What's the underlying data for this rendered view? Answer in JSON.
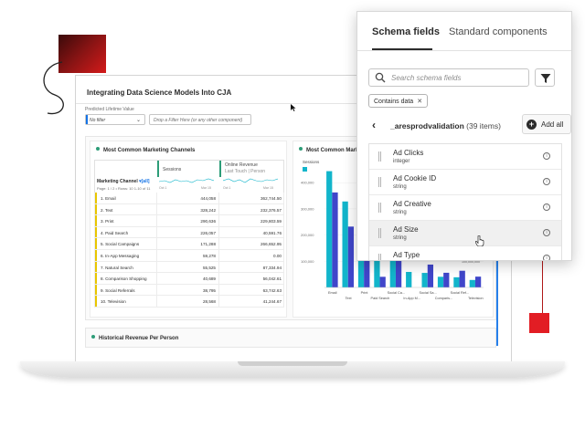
{
  "project": {
    "title": "Integrating Data Science Models Into CJA",
    "dimension_label": "Predicted Lifetime Value",
    "dimension_value": "No filter",
    "drop_zone": "Drop a Filter Here (or any other component)"
  },
  "freeform": {
    "title": "Most Common Marketing Channels",
    "col_sessions": "Sessions",
    "col_revenue": "Online Revenue",
    "col_revenue_sub": "Last Touch | Person",
    "dimension": "Marketing Channel",
    "filter_tag": "[all]",
    "page_info": "Page: 1 / 2 • Rows: 10  1-10 of 11",
    "spark_left": "Oct 1",
    "spark_right": "Mar 15",
    "rows": [
      {
        "name": "1. Email",
        "sessions": "444,058",
        "revenue": "362,744.50"
      },
      {
        "name": "2. Text",
        "sessions": "328,242",
        "revenue": "232,376.57"
      },
      {
        "name": "3. Print",
        "sessions": "290,636",
        "revenue": "229,803.59"
      },
      {
        "name": "4. Paid Search",
        "sessions": "226,057",
        "revenue": "40,591.76"
      },
      {
        "name": "5. Social Campaigns",
        "sessions": "171,288",
        "revenue": "266,652.95"
      },
      {
        "name": "6. In-App Messaging",
        "sessions": "59,278",
        "revenue": "0.00"
      },
      {
        "name": "7. Natural Search",
        "sessions": "55,525",
        "revenue": "87,334.94"
      },
      {
        "name": "8. Comparison Shopping",
        "sessions": "40,689",
        "revenue": "56,042.61"
      },
      {
        "name": "9. Social Referrals",
        "sessions": "38,795",
        "revenue": "63,742.63"
      },
      {
        "name": "10. Television",
        "sessions": "28,568",
        "revenue": "41,244.67"
      }
    ]
  },
  "bar_viz": {
    "title": "Most Common Marketing Channels",
    "legend": "Sessions"
  },
  "chart_data": {
    "type": "bar",
    "categories": [
      "Email",
      "Text",
      "Print",
      "Paid Search",
      "Social Ca...",
      "In-App M...",
      "Social Sa...",
      "Comparis...",
      "Social Ref...",
      "Television"
    ],
    "series": [
      {
        "name": "Sessions",
        "values": [
          444058,
          328242,
          290636,
          226057,
          171288,
          59278,
          55525,
          40689,
          38795,
          28568
        ]
      },
      {
        "values": [
          362744.5,
          232376.57,
          229803.59,
          40591.76,
          266652.95,
          0,
          87334.94,
          56042.61,
          63742.63,
          41244.67
        ]
      }
    ],
    "y_ticks": [
      "400,000",
      "300,000",
      "200,000",
      "100,000"
    ],
    "right_tick": "100,000,000",
    "ylim": [
      0,
      460000
    ],
    "colors": [
      "#12b5cb",
      "#4046ca"
    ]
  },
  "collapsed_viz": {
    "title": "Historical Revenue Per Person"
  },
  "schema": {
    "tab_active": "Schema fields",
    "tab_other": "Standard components",
    "search_placeholder": "Search schema fields",
    "chip": "Contains data",
    "path": "_aresprodvalidation",
    "count": "(39 items)",
    "add_all": "Add all",
    "items": [
      {
        "name": "Ad Clicks",
        "type": "integer"
      },
      {
        "name": "Ad Cookie ID",
        "type": "string"
      },
      {
        "name": "Ad Creative",
        "type": "string"
      },
      {
        "name": "Ad Size",
        "type": "string"
      },
      {
        "name": "Ad Type",
        "type": "string"
      }
    ]
  }
}
